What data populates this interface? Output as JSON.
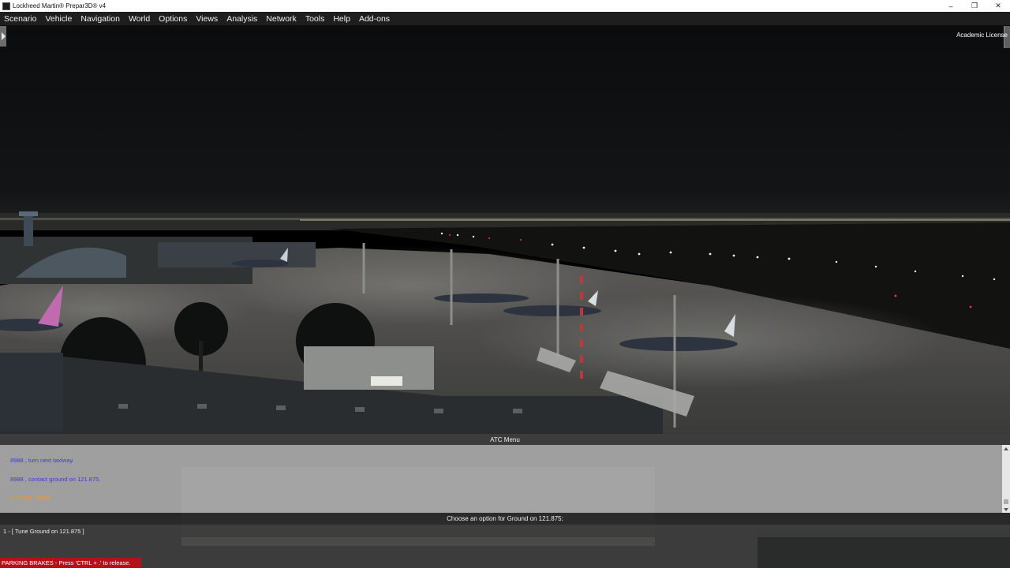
{
  "window": {
    "title": "Lockheed Martin® Prepar3D® v4",
    "icon": "prepar3d-app-icon",
    "controls": {
      "minimize": "–",
      "restore": "❐",
      "close": "✕"
    }
  },
  "menu": {
    "items": [
      "Scenario",
      "Vehicle",
      "Navigation",
      "World",
      "Options",
      "Views",
      "Analysis",
      "Network",
      "Tools",
      "Help",
      "Add-ons"
    ]
  },
  "overlay": {
    "license": "Academic License"
  },
  "atc": {
    "header": "ATC Menu",
    "messages": [
      {
        "text": "8988 , turn next taxiway.",
        "color": "#3d3dc8"
      },
      {
        "text": "8988 , contact ground on 121.875.",
        "color": "#3d3dc8"
      },
      {
        "text": "121.875 , 8988",
        "color": "#f39a1c"
      }
    ],
    "prompt": "Choose an option for  Ground on 121.875:",
    "options": [
      "1 - [ Tune  Ground on 121.875 ]"
    ]
  },
  "status": {
    "parking_brakes": "PARKING BRAKES - Press 'CTRL + .' to release.",
    "parking_brakes_color": "#b3121a"
  },
  "colors": {
    "menubar": "#1e1e1e",
    "sky": "#0c0d0e",
    "apron": "#4d4c4a"
  }
}
